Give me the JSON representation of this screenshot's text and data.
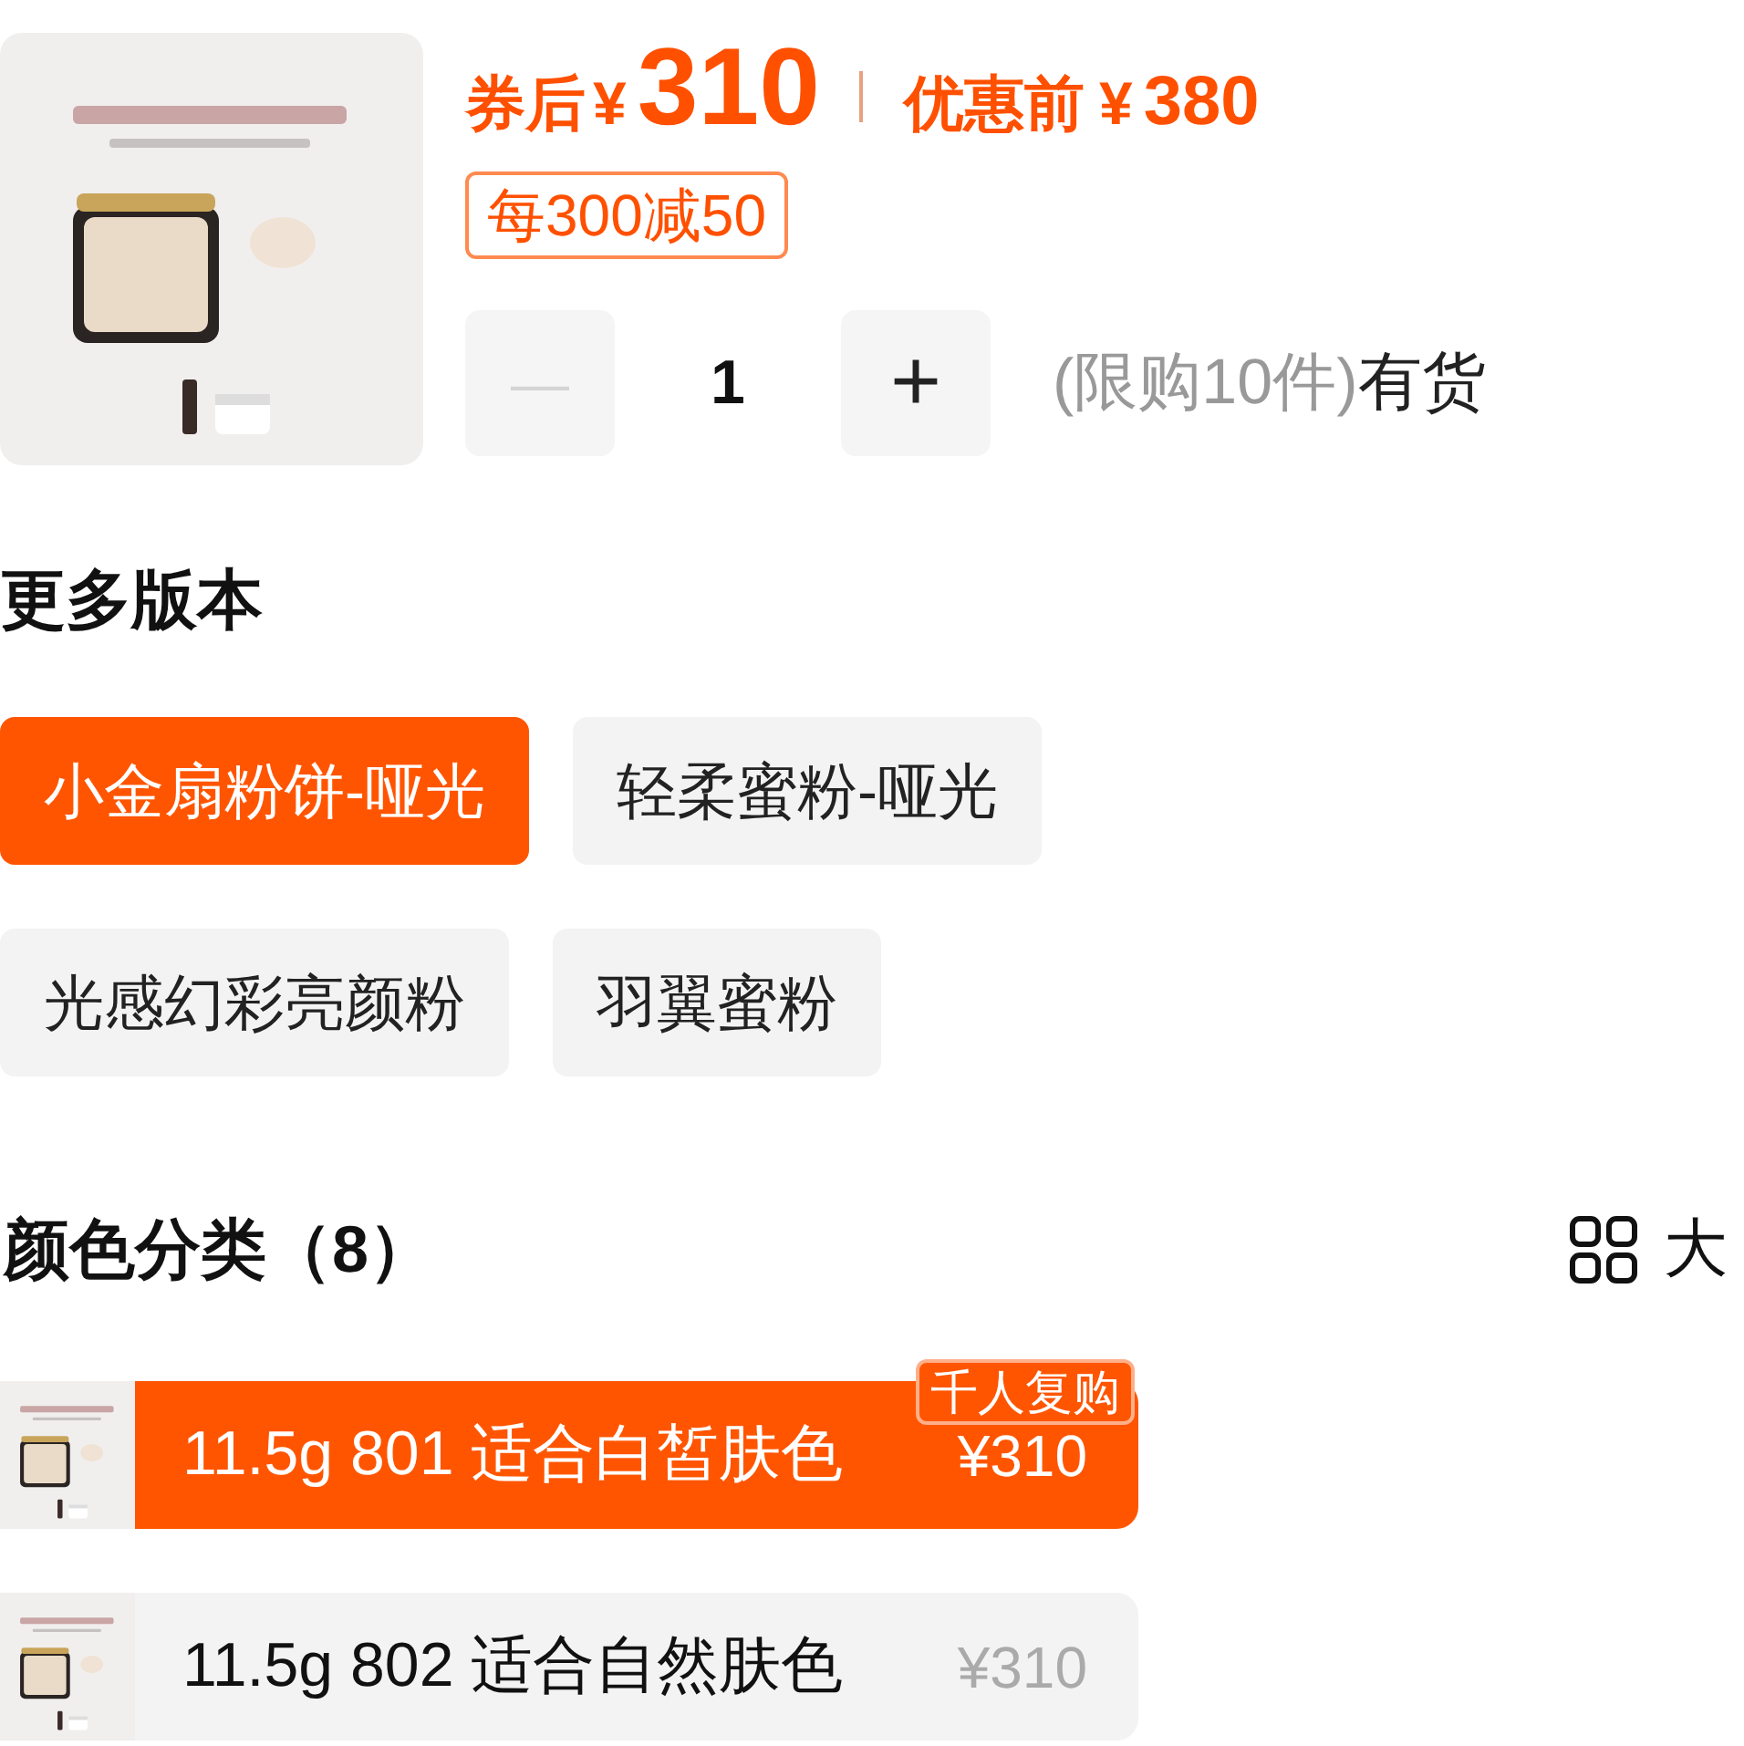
{
  "product": {
    "price_label": "券后",
    "currency": "¥",
    "price": "310",
    "original_label": "优惠前",
    "original_currency": "¥",
    "original_price": "380",
    "promo": "每300减50"
  },
  "quantity": {
    "minus": "—",
    "value": "1",
    "plus": "+",
    "minus_disabled": true,
    "limit": "(限购10件)",
    "stock": "有货"
  },
  "versions": {
    "title": "更多版本",
    "items": [
      {
        "label": "小金扇粉饼-哑光",
        "selected": true
      },
      {
        "label": "轻柔蜜粉-哑光",
        "selected": false
      },
      {
        "label": "光感幻彩亮颜粉",
        "selected": false
      },
      {
        "label": "羽翼蜜粉",
        "selected": false
      }
    ]
  },
  "colors": {
    "title": "颜色分类（8）",
    "view_toggle": "大",
    "items": [
      {
        "label": "11.5g 801 适合白皙肤色",
        "price": "¥310",
        "badge": "千人复购",
        "selected": true
      },
      {
        "label": "11.5g 802 适合自然肤色",
        "price": "¥310",
        "selected": false
      }
    ]
  }
}
